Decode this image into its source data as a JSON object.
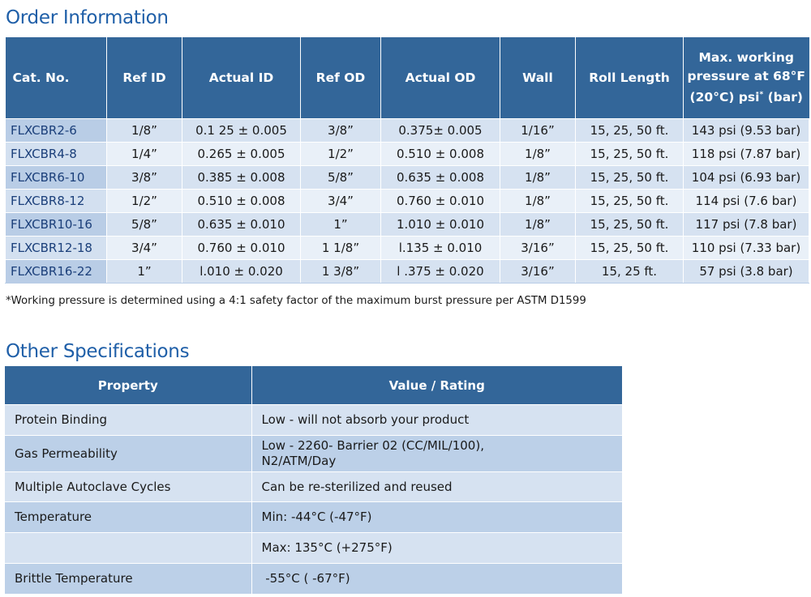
{
  "order": {
    "title": "Order Information",
    "headers": [
      "Cat. No.",
      "Ref ID",
      "Actual ID",
      "Ref OD",
      "Actual OD",
      "Wall",
      "Roll Length"
    ],
    "last_header": {
      "line1": "Max. working",
      "line2": "pressure at 68°F",
      "line3": "(20°C) psi",
      "sup": "*",
      "line3_tail": " (bar)"
    },
    "rows": [
      [
        "FLXCBR2-6",
        "1/8”",
        "0.1 25 ± 0.005",
        "3/8”",
        "0.375± 0.005",
        "1/16”",
        "15, 25, 50 ft.",
        "143 psi (9.53 bar)"
      ],
      [
        "FLXCBR4-8",
        "1/4”",
        "0.265 ± 0.005",
        "1/2”",
        "0.510 ± 0.008",
        "1/8”",
        "15, 25, 50 ft.",
        "118 psi (7.87 bar)"
      ],
      [
        "FLXCBR6-10",
        "3/8”",
        "0.385 ± 0.008",
        "5/8”",
        "0.635 ± 0.008",
        "1/8”",
        "15, 25, 50 ft.",
        "104 psi (6.93 bar)"
      ],
      [
        "FLXCBR8-12",
        "1/2”",
        "0.510 ± 0.008",
        "3/4”",
        "0.760 ± 0.010",
        "1/8”",
        "15, 25, 50 ft.",
        "114 psi (7.6 bar)"
      ],
      [
        "FLXCBR10-16",
        "5/8”",
        "0.635 ± 0.010",
        "1”",
        "1.010 ± 0.010",
        "1/8”",
        "15, 25, 50 ft.",
        "117 psi (7.8 bar)"
      ],
      [
        "FLXCBR12-18",
        "3/4”",
        "0.760 ± 0.010",
        "1 1/8”",
        "l.135 ± 0.010",
        "3/16”",
        "15, 25, 50 ft.",
        "110 psi (7.33 bar)"
      ],
      [
        "FLXCBR16-22",
        "1”",
        "l.010 ± 0.020",
        "1 3/8”",
        "l .375 ± 0.020",
        "3/16”",
        "15, 25 ft.",
        "57 psi (3.8 bar)"
      ]
    ],
    "footnote": "*Working pressure is determined using a 4:1 safety factor of the maximum burst pressure per ASTM D1599"
  },
  "specs": {
    "title": "Other Specifications",
    "headers": [
      "Property",
      "Value / Rating"
    ],
    "rows": [
      {
        "property": "Protein Binding",
        "value": [
          "Low - will not absorb your product"
        ]
      },
      {
        "property": "Gas Permeability",
        "value": [
          "Low - 2260- Barrier 02 (CC/MIL/100),",
          "N2/ATM/Day"
        ]
      },
      {
        "property": "Multiple Autoclave Cycles",
        "value": [
          "Can be re-sterilized and reused"
        ]
      },
      {
        "property": "Temperature",
        "value": [
          "Min: -44°C (-47°F)"
        ]
      },
      {
        "property": "",
        "value": [
          "Max: 135°C (+275°F)"
        ]
      },
      {
        "property": "Brittle Temperature",
        "value": [
          " -55°C ( -67°F)"
        ]
      }
    ]
  }
}
